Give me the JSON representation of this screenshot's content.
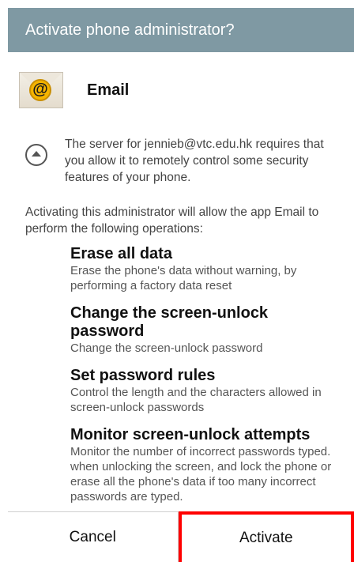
{
  "dialog": {
    "title": "Activate phone administrator?"
  },
  "app": {
    "name": "Email",
    "icon": "email-at-icon",
    "icon_glyph": "@"
  },
  "notice": {
    "text": "The server for jennieb@vtc.edu.hk requires that you allow it to remotely control some security features of your phone."
  },
  "intro": "Activating this administrator will allow the app Email to perform the following operations:",
  "operations": [
    {
      "title": "Erase all data",
      "description": "Erase the phone's data without warning, by performing a factory data reset"
    },
    {
      "title": "Change the screen-unlock password",
      "description": "Change the screen-unlock password"
    },
    {
      "title": "Set password rules",
      "description": "Control the length and the characters allowed in screen-unlock passwords"
    },
    {
      "title": "Monitor screen-unlock attempts",
      "description": "Monitor the number of incorrect passwords typed. when unlocking the screen, and lock the phone or erase all the phone's data if too many incorrect passwords are typed."
    }
  ],
  "buttons": {
    "cancel": "Cancel",
    "activate": "Activate"
  },
  "colors": {
    "header": "#7f99a3",
    "highlight": "#ff0000",
    "icon_badge": "#f6b400"
  }
}
